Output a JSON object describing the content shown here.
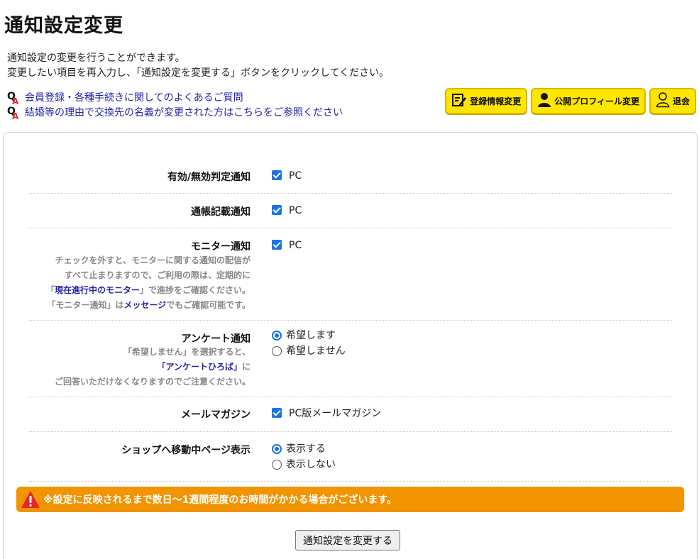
{
  "page": {
    "title": "通知設定変更",
    "intro": [
      "通知設定の変更を行うことができます。",
      "変更したい項目を再入力し、「通知設定を変更する」ボタンをクリックしてください。"
    ]
  },
  "faq_links": [
    "会員登録・各種手続きに関してのよくあるご質問",
    "結婚等の理由で交換先の名義が変更された方はこちらをご参照ください"
  ],
  "top_buttons": {
    "edit_profile": "登録情報変更",
    "public_profile": "公開プロフィール変更",
    "withdraw": "退会"
  },
  "settings": {
    "validity": {
      "label": "有効/無効判定通知",
      "option": "PC",
      "checked": true
    },
    "passbook": {
      "label": "通帳記載通知",
      "option": "PC",
      "checked": true
    },
    "monitor": {
      "label": "モニター通知",
      "option": "PC",
      "checked": true,
      "note_line1": "チェックを外すと、モニターに関する通知の配信が",
      "note_line2": "すべて止まりますので、ご利用の際は、定期的に",
      "note_line3_pre": "「",
      "note_line3_link": "現在進行中のモニター",
      "note_line3_post": "」で進捗をご確認ください。",
      "note_line4_pre": "「モニター通知」は",
      "note_line4_link": "メッセージ",
      "note_line4_post": "でもご確認可能です。"
    },
    "survey": {
      "label": "アンケート通知",
      "option_yes": "希望します",
      "option_no": "希望しません",
      "selected": "希望します",
      "note_line1": "「希望しません」を選択すると、",
      "note_line2_link": "「アンケートひろば」",
      "note_line2_post": "に",
      "note_line3": "ご回答いただけなくなりますのでご注意ください。"
    },
    "mail_magazine": {
      "label": "メールマガジン",
      "option": "PC版メールマガジン",
      "checked": true
    },
    "shop_page": {
      "label": "ショップへ移動中ページ表示",
      "option_show": "表示する",
      "option_hide": "表示しない",
      "selected": "表示する"
    }
  },
  "warning": "※設定に反映されるまで数日〜1週間程度のお時間がかかる場合がございます。",
  "submit_label": "通知設定を変更する",
  "colors": {
    "accent_blue": "#1a73e8",
    "link": "#2222aa",
    "button_yellow": "#ffe500",
    "warning_orange": "#f29300",
    "warning_icon_red": "#e3262b"
  },
  "icons": {
    "qa": "qa-icon",
    "edit": "edit-icon",
    "user": "user-icon",
    "withdraw": "user-outline-icon",
    "warning": "warning-triangle-icon"
  }
}
